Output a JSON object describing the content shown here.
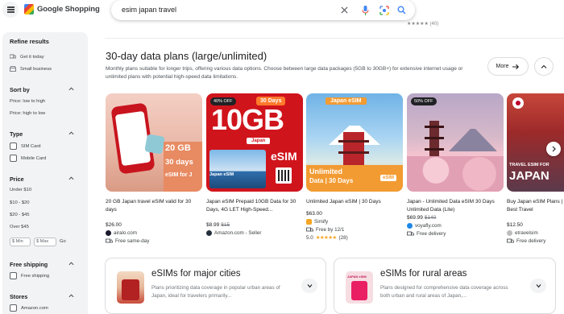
{
  "header": {
    "logo_text": "Google Shopping",
    "search_value": "esim japan travel"
  },
  "top_rating_text": "★★★★★ (40)",
  "sidebar": {
    "title": "Refine results",
    "quick": [
      "Get it today",
      "Small business"
    ],
    "sort_by": {
      "label": "Sort by",
      "options": [
        "Price: low to high",
        "Price: high to low"
      ]
    },
    "type": {
      "label": "Type",
      "options": [
        "SIM Card",
        "Mobile Card"
      ]
    },
    "price": {
      "label": "Price",
      "options": [
        "Under $10",
        "$10 - $20",
        "$20 - $45",
        "Over $45"
      ],
      "min_placeholder": "$ Min",
      "max_placeholder": "$ Max",
      "go": "Go"
    },
    "free_shipping": {
      "label": "Free shipping",
      "option": "Free shipping"
    },
    "stores": {
      "label": "Stores",
      "option": "Amazon.com"
    }
  },
  "section": {
    "title": "30-day data plans (large/unlimited)",
    "description": "Monthly plans suitable for longer trips, offering various data options. Choose between large data packages (5GB to 30GB+) for extensive internet usage or unlimited plans with potential high-speed data limitations.",
    "more_label": "More"
  },
  "products": [
    {
      "title": "20 GB Japan travel eSIM valid for 30 days",
      "price": "$26.00",
      "old_price": "",
      "seller": "airalo.com",
      "extra": "Free same-day",
      "image": {
        "big": "20 GB",
        "sub": "30 days",
        "small": "eSIM for J"
      }
    },
    {
      "title": "Japan eSIM Prepaid 10GB Data for 30 Days, 4G LET High-Speed...",
      "price": "$8.99",
      "old_price": "$15",
      "seller": "Amazon.com - Seller",
      "badge": "40% OFF",
      "image": {
        "tag": "30 Days",
        "big": "10GB",
        "ribbon": "Japan",
        "esim": "eSIM",
        "small": "Japan eSIM"
      }
    },
    {
      "title": "Unlimited Japan eSIM | 30 Days",
      "price": "$63.00",
      "old_price": "",
      "seller": "Simify",
      "extra": "Free by 12/1",
      "rating": "5.0",
      "rating_stars": "★★★★★",
      "rating_count": "(28)",
      "image": {
        "top": "Japan eSIM",
        "line1": "Unlimited",
        "line2": "Data | 30 Days",
        "esim": "eSIM"
      }
    },
    {
      "title": "Japan - Unlimited Data eSIM 30 Days Unlimited Data (Lite)",
      "price": "$69.99",
      "old_price": "$140",
      "seller": "voyafly.com",
      "extra": "Free delivery",
      "badge": "50% OFF"
    },
    {
      "title": "Buy Japan eSIM Plans | Best Travel",
      "price": "$12.50",
      "old_price": "",
      "seller": "etravelsim",
      "extra": "Free delivery",
      "image": {
        "line1": "TRAVEL ESIM FOR",
        "line2": "JAPAN"
      }
    }
  ],
  "categories": [
    {
      "title": "eSIMs for major cities",
      "description": "Plans prioritizing data coverage in popular urban areas of Japan, ideal for travelers primarily..."
    },
    {
      "title": "eSIMs for rural areas",
      "description": "Plans designed for comprehensive data coverage across both urban and rural areas of Japan,...",
      "thumb_text": "JAPAN eSIM"
    }
  ]
}
